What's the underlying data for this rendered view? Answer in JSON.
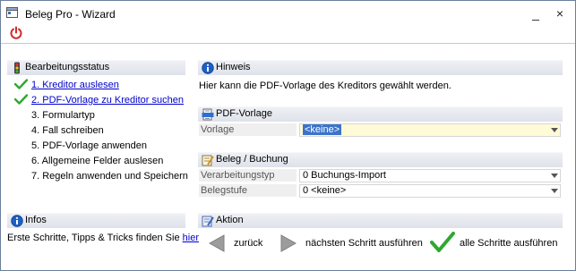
{
  "window": {
    "title": "Beleg Pro - Wizard"
  },
  "titlebar": {
    "minimize": "_",
    "close": "×"
  },
  "status": {
    "title": "Bearbeitungsstatus",
    "steps": [
      {
        "label": "1. Kreditor auslesen",
        "done": true
      },
      {
        "label": "2. PDF-Vorlage zu Kreditor suchen",
        "done": true
      },
      {
        "label": "3. Formulartyp",
        "done": false
      },
      {
        "label": "4. Fall schreiben",
        "done": false
      },
      {
        "label": "5. PDF-Vorlage anwenden",
        "done": false
      },
      {
        "label": "6. Allgemeine Felder auslesen",
        "done": false
      },
      {
        "label": "7. Regeln anwenden und Speichern",
        "done": false
      }
    ]
  },
  "hint": {
    "title": "Hinweis",
    "text": "Hier kann die PDF-Vorlage des Kreditors gewählt werden."
  },
  "pdf": {
    "title": "PDF-Vorlage",
    "vorlage_label": "Vorlage",
    "vorlage_value": "<keine>"
  },
  "beleg": {
    "title": "Beleg / Buchung",
    "typ_label": "Verarbeitungstyp",
    "typ_value": "0 Buchungs-Import",
    "stufe_label": "Belegstufe",
    "stufe_value": "0 <keine>"
  },
  "infos": {
    "title": "Infos",
    "text": "Erste Schritte, Tipps & Tricks finden Sie ",
    "link": "hier"
  },
  "aktion": {
    "title": "Aktion",
    "back": "zurück",
    "next": "nächsten Schritt ausführen",
    "all": "alle Schritte ausführen"
  },
  "colors": {
    "check_green": "#2fa82f",
    "link_blue": "#0000cc",
    "selection": "#3b73c9",
    "power_red": "#d42a2a"
  }
}
